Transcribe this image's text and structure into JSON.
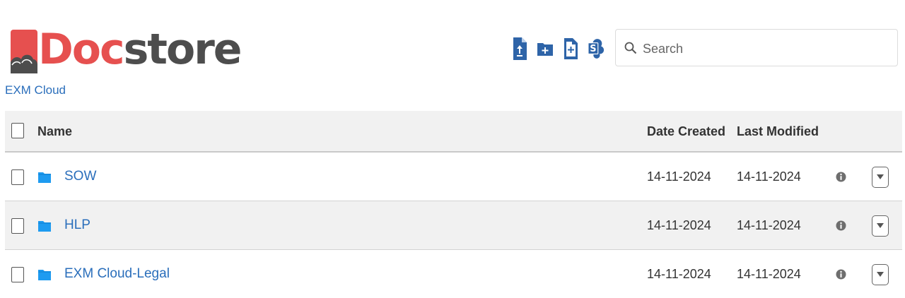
{
  "brand": {
    "part1": "Doc",
    "part2": "store",
    "color_primary": "#e6504f",
    "color_secondary": "#4d4d4d"
  },
  "breadcrumb": {
    "label": "EXM Cloud"
  },
  "toolbar": {
    "accent": "#2e64a8",
    "buttons": [
      "upload-file-icon",
      "new-folder-icon",
      "new-document-icon",
      "sharepoint-icon"
    ]
  },
  "search": {
    "placeholder": "Search",
    "value": ""
  },
  "table": {
    "columns": {
      "name": "Name",
      "date_created": "Date Created",
      "last_modified": "Last Modified"
    },
    "rows": [
      {
        "name": "SOW",
        "date_created": "14-11-2024",
        "last_modified": "14-11-2024"
      },
      {
        "name": "HLP",
        "date_created": "14-11-2024",
        "last_modified": "14-11-2024"
      },
      {
        "name": "EXM Cloud-Legal",
        "date_created": "14-11-2024",
        "last_modified": "14-11-2024"
      }
    ]
  },
  "colors": {
    "link": "#2a6ebb",
    "folder": "#1e9bf0",
    "header_bg": "#f1f1f1"
  }
}
